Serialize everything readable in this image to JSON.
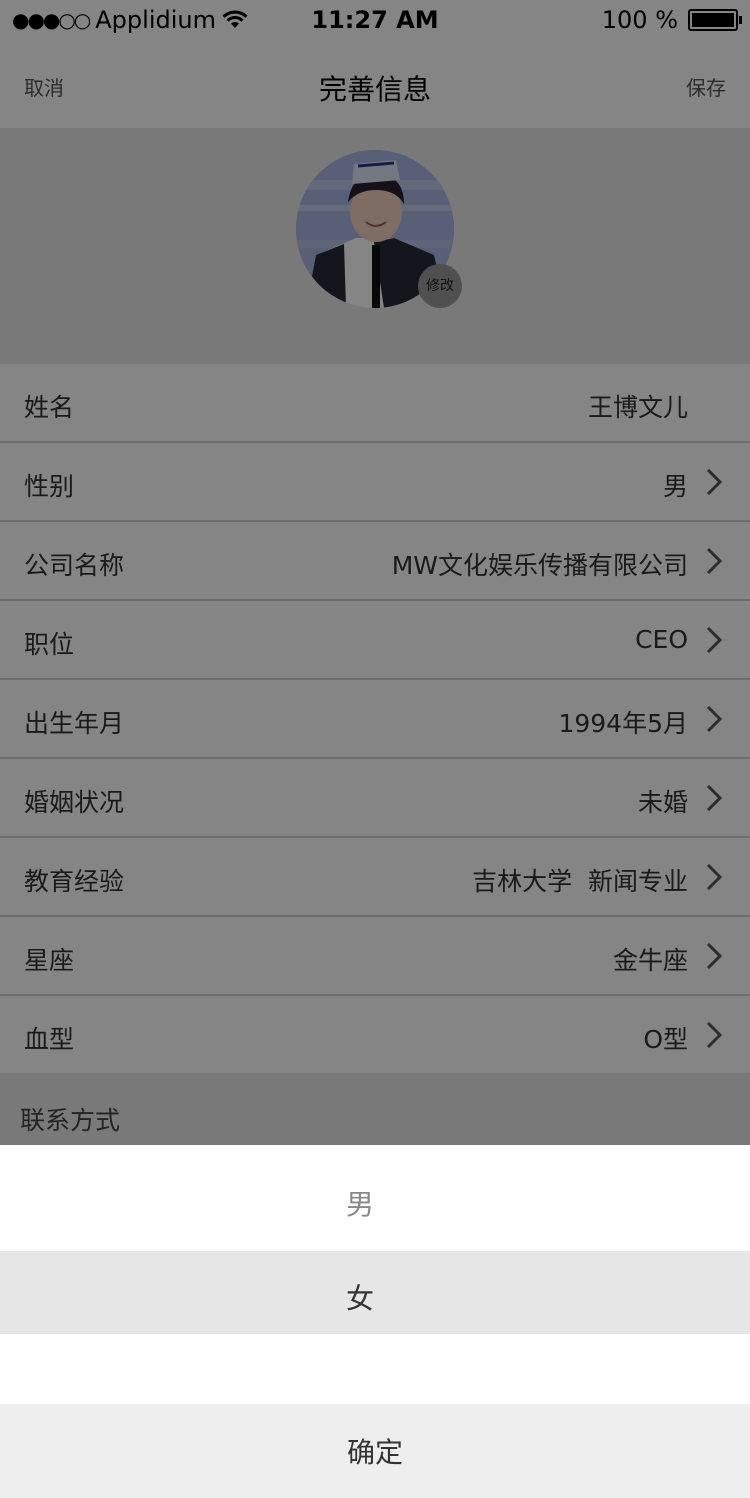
{
  "status_bar": {
    "signal": "●●●○○",
    "carrier": "Applidium",
    "time": "11:27 AM",
    "battery": "100 %"
  },
  "nav": {
    "cancel": "取消",
    "title": "完善信息",
    "save": "保存"
  },
  "avatar": {
    "edit_label": "修改"
  },
  "profile_rows": [
    {
      "label": "姓名",
      "value": "王博文儿"
    },
    {
      "label": "性别",
      "value": "男"
    },
    {
      "label": "公司名称",
      "value": "MW文化娱乐传播有限公司"
    },
    {
      "label": "职位",
      "value": "CEO"
    },
    {
      "label": "出生年月",
      "value": "1994年5月"
    },
    {
      "label": "婚姻状况",
      "value": "未婚"
    },
    {
      "label": "教育经验",
      "value": "吉林大学  新闻专业"
    },
    {
      "label": "星座",
      "value": "金牛座"
    },
    {
      "label": "血型",
      "value": "O型"
    }
  ],
  "contact_section": {
    "label": "联系方式"
  },
  "picker": {
    "options": [
      "男",
      "女"
    ],
    "confirm": "确定"
  }
}
